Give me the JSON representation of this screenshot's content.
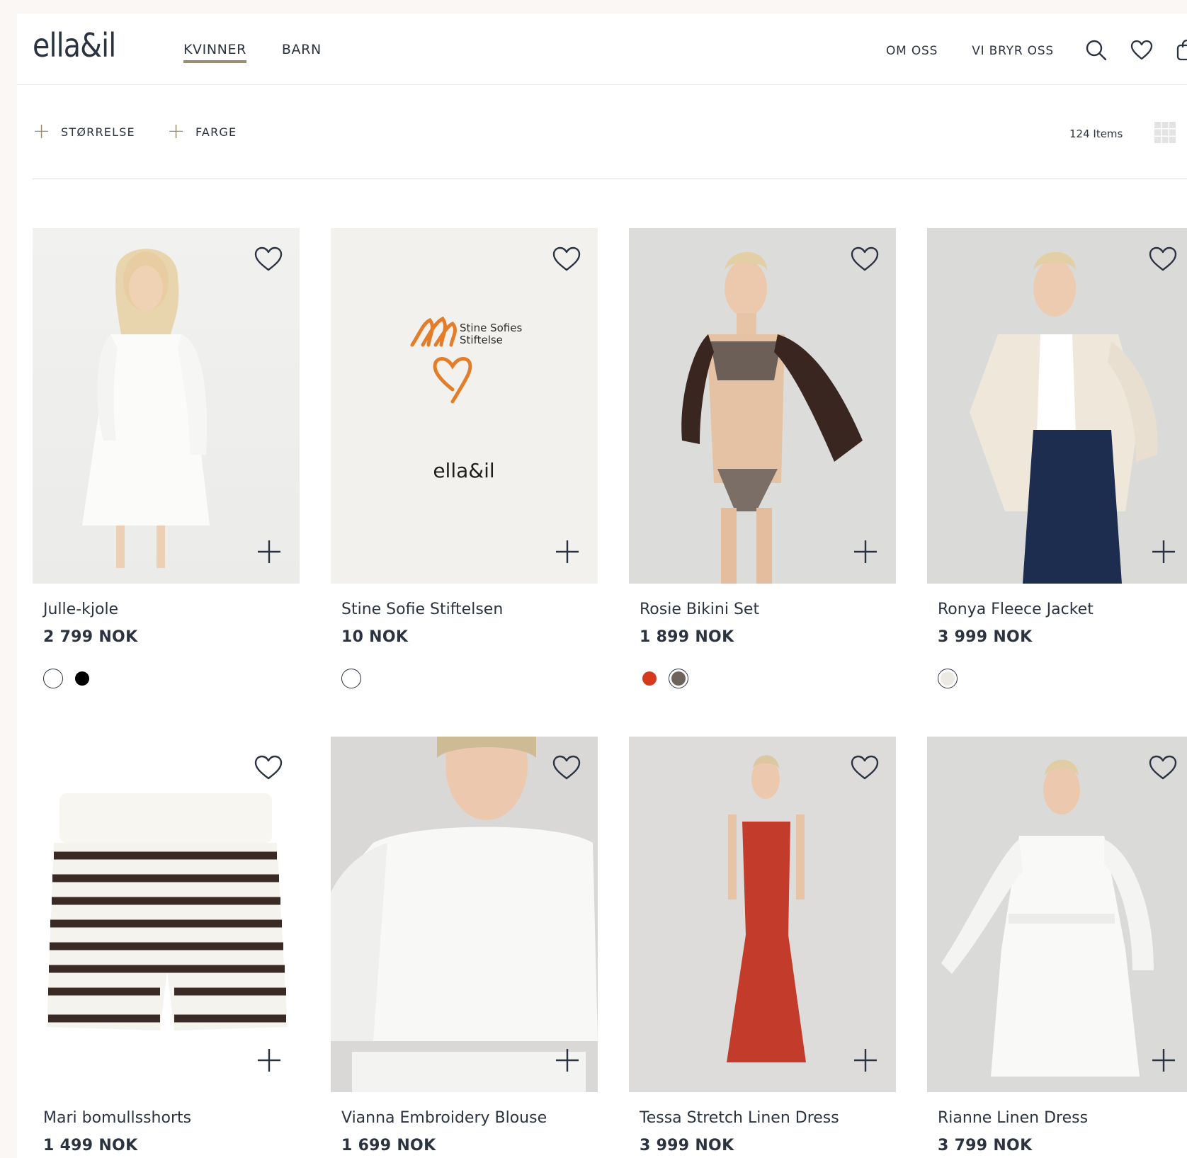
{
  "header": {
    "logo": "ella&il",
    "nav_left": [
      {
        "label": "KVINNER",
        "active": true
      },
      {
        "label": "BARN",
        "active": false
      }
    ],
    "nav_right": [
      {
        "label": "OM OSS"
      },
      {
        "label": "VI BRYR OSS"
      }
    ],
    "icons": [
      "search-icon",
      "heart-icon",
      "bag-icon"
    ]
  },
  "filters": {
    "items": [
      {
        "label": "STØRRELSE",
        "icon": "plus-icon"
      },
      {
        "label": "FARGE",
        "icon": "plus-icon"
      }
    ],
    "count": "124 Items",
    "view_icons": [
      "grid-small-icon",
      "grid-large-icon"
    ]
  },
  "colors": {
    "text": "#2b3340",
    "accent": "#9c8c74",
    "page_bg": "#fbf7f4"
  },
  "products": [
    {
      "name": "Julle-kjole",
      "price": "2 799 NOK",
      "swatches": [
        "#ffffff",
        "#000000"
      ],
      "image": "white-dress-photo"
    },
    {
      "name": "Stine Sofie Stiftelsen",
      "price": "10 NOK",
      "swatches": [
        "#ffffff"
      ],
      "image": "stine-sofie-card",
      "card_logo_text": "Stine Sofies Stiftelse",
      "card_brand": "ella&il"
    },
    {
      "name": "Rosie Bikini Set",
      "price": "1 899 NOK",
      "swatches": [
        "#d63a1e",
        "#6e645c"
      ],
      "image": "bikini-photo"
    },
    {
      "name": "Ronya Fleece Jacket",
      "price": "3 999 NOK",
      "swatches": [
        "#ece8e2"
      ],
      "image": "fleece-jacket-photo"
    },
    {
      "name": "Mari bomullsshorts",
      "price": "1 499 NOK",
      "swatches": [],
      "image": "striped-shorts-photo"
    },
    {
      "name": "Vianna Embroidery Blouse",
      "price": "1 699 NOK",
      "swatches": [],
      "image": "blouse-photo"
    },
    {
      "name": "Tessa Stretch Linen Dress",
      "price": "3 999 NOK",
      "swatches": [],
      "image": "red-dress-photo"
    },
    {
      "name": "Rianne Linen Dress",
      "price": "3 799 NOK",
      "swatches": [],
      "image": "white-linen-dress-photo"
    }
  ]
}
